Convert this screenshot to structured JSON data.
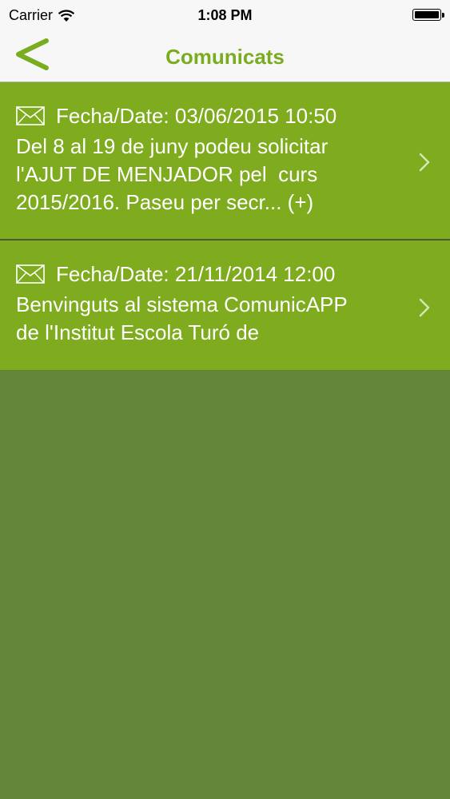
{
  "status_bar": {
    "carrier": "Carrier",
    "time": "1:08 PM"
  },
  "nav": {
    "back_icon": "chevron-left-icon",
    "title": "Comunicats"
  },
  "colors": {
    "accent": "#7aac1f",
    "row_background": "#7fab1e",
    "page_background": "#628537"
  },
  "messages": [
    {
      "date": "Fecha/Date: 03/06/2015 10:50",
      "text": "Del 8 al 19 de juny podeu solicitar\nl'AJUT DE MENJADOR pel  curs\n2015/2016. Paseu per secr... (+)"
    },
    {
      "date": "Fecha/Date: 21/11/2014 12:00",
      "text": "Benvinguts al sistema ComunicAPP\nde l'Institut Escola Turó de"
    }
  ]
}
